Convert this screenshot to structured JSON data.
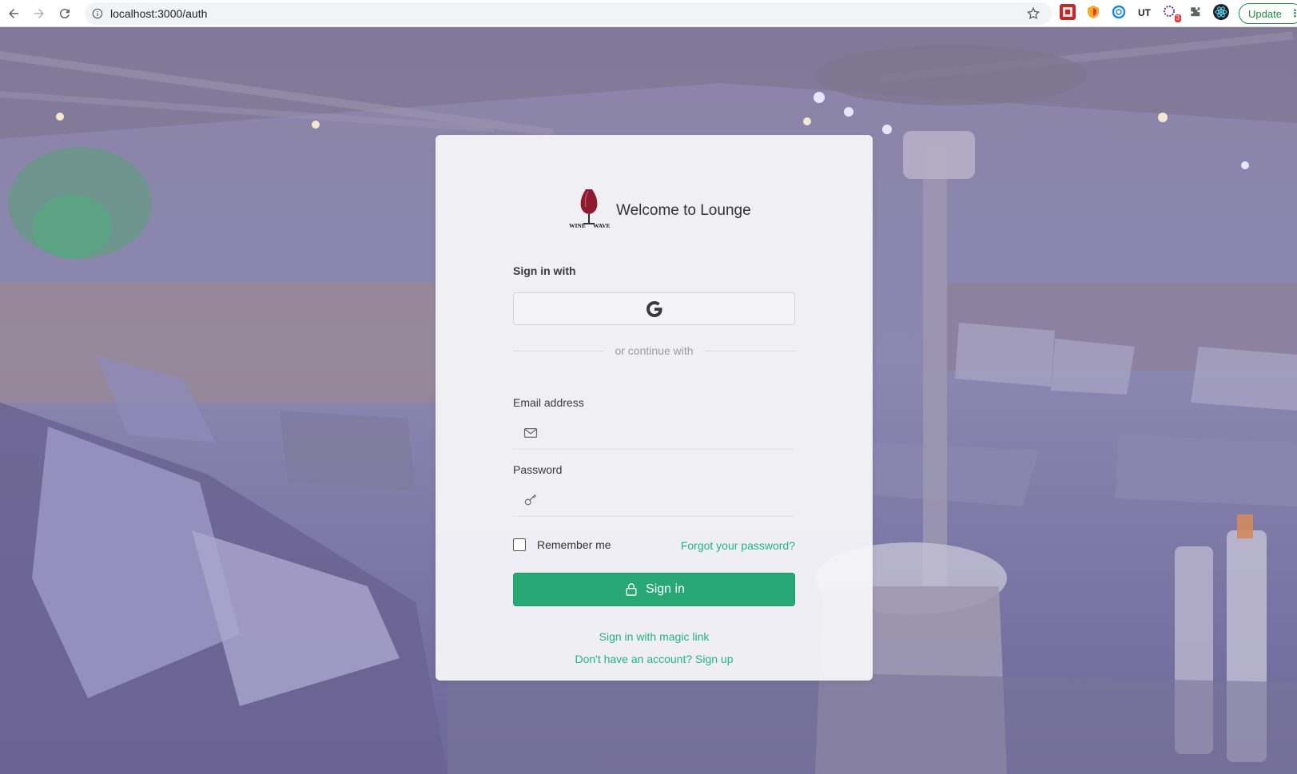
{
  "browser": {
    "url": "localhost:3000/auth",
    "update_label": "Update",
    "menu_glyph": "⋮",
    "icons": [
      "back-icon",
      "forward-icon",
      "reload-icon",
      "info-icon",
      "star-icon",
      "puzzle-icon"
    ],
    "extension_badge": "3"
  },
  "auth": {
    "logo_text": "WINE WAVE",
    "welcome": "Welcome to Lounge",
    "sign_in_with": "Sign in with",
    "divider_text": "or continue with",
    "email_label": "Email address",
    "email_value": "",
    "password_label": "Password",
    "password_value": "",
    "remember_label": "Remember me",
    "forgot_label": "Forgot your password?",
    "signin_label": "Sign in",
    "magic_link_label": "Sign in with magic link",
    "signup_label": "Don't have an account? Sign up"
  },
  "colors": {
    "accent": "#27a874",
    "link": "#24b47e",
    "background_tint": "#7a74a3"
  }
}
